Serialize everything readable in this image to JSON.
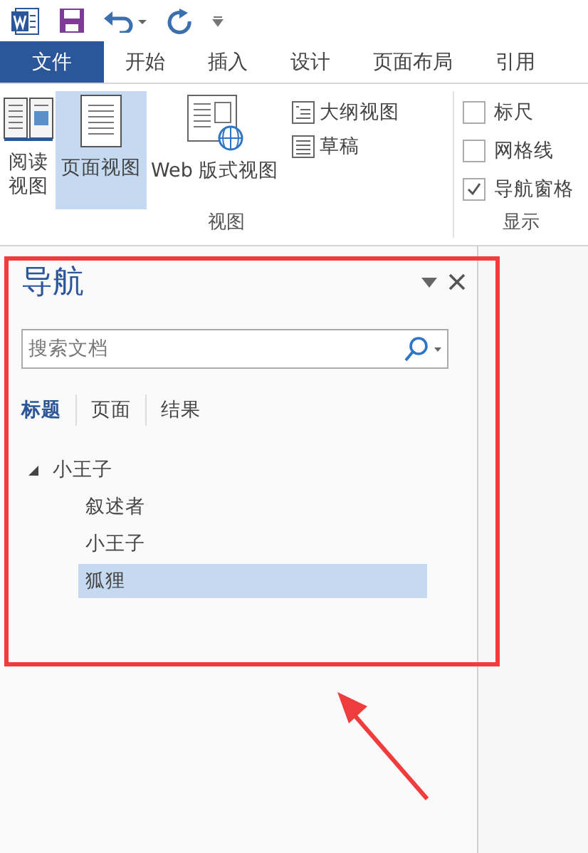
{
  "tabs": [
    {
      "label": "文件",
      "kind": "file",
      "selected": false
    },
    {
      "label": "开始",
      "kind": "normal",
      "selected": false
    },
    {
      "label": "插入",
      "kind": "normal",
      "selected": false
    },
    {
      "label": "设计",
      "kind": "normal",
      "selected": false
    },
    {
      "label": "页面布局",
      "kind": "normal",
      "selected": false
    },
    {
      "label": "引用",
      "kind": "normal",
      "selected": false
    }
  ],
  "view_group": {
    "label": "视图",
    "large_buttons": [
      {
        "label": "阅读视图",
        "kind": "read",
        "selected": false
      },
      {
        "label": "页面视图",
        "kind": "page",
        "selected": true
      },
      {
        "label": "Web 版式视图",
        "kind": "web",
        "selected": false
      }
    ],
    "small_buttons": [
      {
        "label": "大纲视图",
        "kind": "outline"
      },
      {
        "label": "草稿",
        "kind": "draft"
      }
    ]
  },
  "show_group": {
    "label": "显示",
    "checkboxes": [
      {
        "label": "标尺",
        "checked": false
      },
      {
        "label": "网格线",
        "checked": false
      },
      {
        "label": "导航窗格",
        "checked": true
      }
    ]
  },
  "navigation": {
    "title": "导航",
    "search": {
      "placeholder": "搜索文档"
    },
    "tabs": [
      {
        "label": "标题",
        "selected": true
      },
      {
        "label": "页面",
        "selected": false
      },
      {
        "label": "结果",
        "selected": false
      }
    ],
    "headings": [
      {
        "label": "小王子",
        "expanded": true,
        "selected": false,
        "children": [
          {
            "label": "叙述者",
            "selected": false
          },
          {
            "label": "小王子",
            "selected": false
          },
          {
            "label": "狐狸",
            "selected": true
          }
        ]
      }
    ]
  }
}
